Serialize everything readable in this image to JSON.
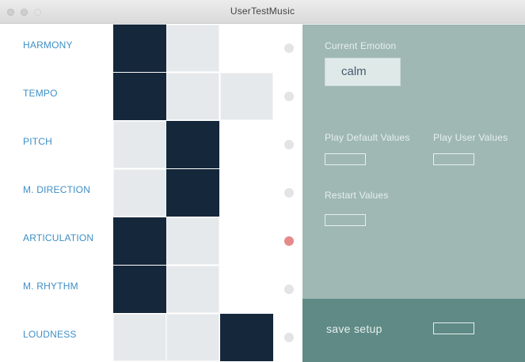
{
  "window": {
    "title": "UserTestMusic"
  },
  "parameters": [
    {
      "label": "HARMONY",
      "cells": [
        "dark",
        "light",
        "white"
      ],
      "selected": false
    },
    {
      "label": "TEMPO",
      "cells": [
        "dark",
        "light",
        "light"
      ],
      "selected": false
    },
    {
      "label": "PITCH",
      "cells": [
        "light",
        "dark",
        "white"
      ],
      "selected": false
    },
    {
      "label": "M. DIRECTION",
      "cells": [
        "light",
        "dark",
        "white"
      ],
      "selected": false
    },
    {
      "label": "ARTICULATION",
      "cells": [
        "dark",
        "light",
        "white"
      ],
      "selected": true
    },
    {
      "label": "M. RHYTHM",
      "cells": [
        "dark",
        "light",
        "white"
      ],
      "selected": false
    },
    {
      "label": "LOUDNESS",
      "cells": [
        "light",
        "light",
        "dark"
      ],
      "selected": false
    }
  ],
  "panel": {
    "current_emotion_label": "Current Emotion",
    "current_emotion_value": "calm",
    "play_default_label": "Play Default Values",
    "play_user_label": "Play User Values",
    "restart_label": "Restart Values",
    "save_label": "save setup"
  },
  "colors": {
    "cell_dark": "#15273a",
    "cell_light": "#e6e9ec",
    "label_blue": "#3e8fc6",
    "panel_bg": "#9fb8b4",
    "panel_bottom_bg": "#5f8a86",
    "dot_active": "#e48a8a"
  }
}
